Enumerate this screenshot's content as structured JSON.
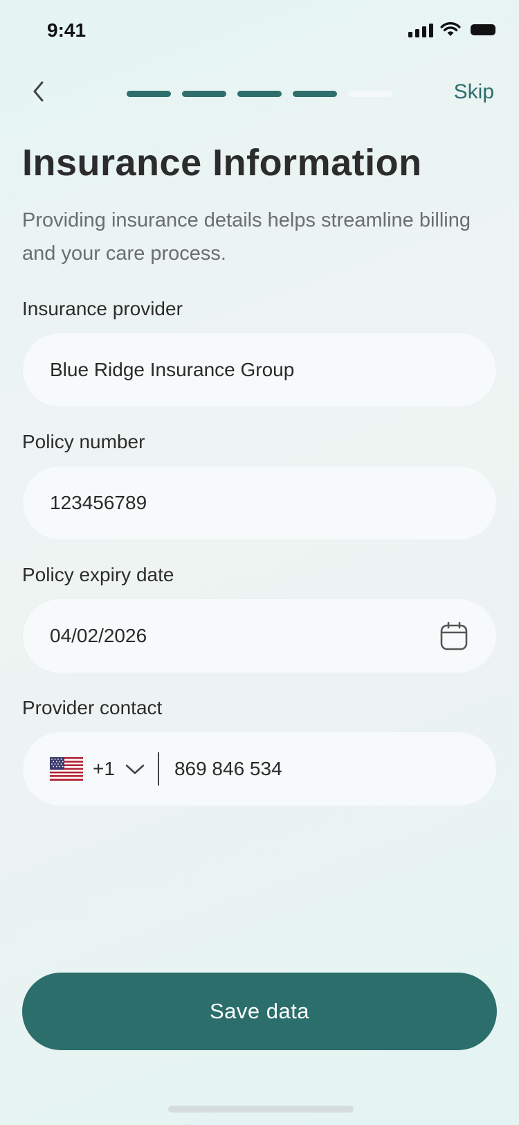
{
  "status_bar": {
    "time": "9:41"
  },
  "header": {
    "back_icon": "chevron-left-icon",
    "progress": {
      "total_steps": 5,
      "completed_steps": 4
    },
    "skip_label": "Skip"
  },
  "page": {
    "title": "Insurance Information",
    "subtitle": "Providing insurance details helps streamline billing and your care process."
  },
  "form": {
    "provider": {
      "label": "Insurance provider",
      "value": "Blue Ridge Insurance Group"
    },
    "policy_number": {
      "label": "Policy number",
      "value": "123456789"
    },
    "expiry_date": {
      "label": "Policy expiry date",
      "value": "04/02/2026",
      "icon": "calendar-icon"
    },
    "contact": {
      "label": "Provider contact",
      "country_flag": "us-flag-icon",
      "dial_code": "+1",
      "dropdown_icon": "chevron-down-icon",
      "value": "869 846 534"
    }
  },
  "actions": {
    "save_label": "Save data"
  },
  "colors": {
    "accent": "#2B6E6C",
    "progress_inactive": "#F4F8F8",
    "field_background": "#F6FAFA",
    "title_text": "#2C2C2C",
    "subtitle_text": "#6B6E6E"
  }
}
